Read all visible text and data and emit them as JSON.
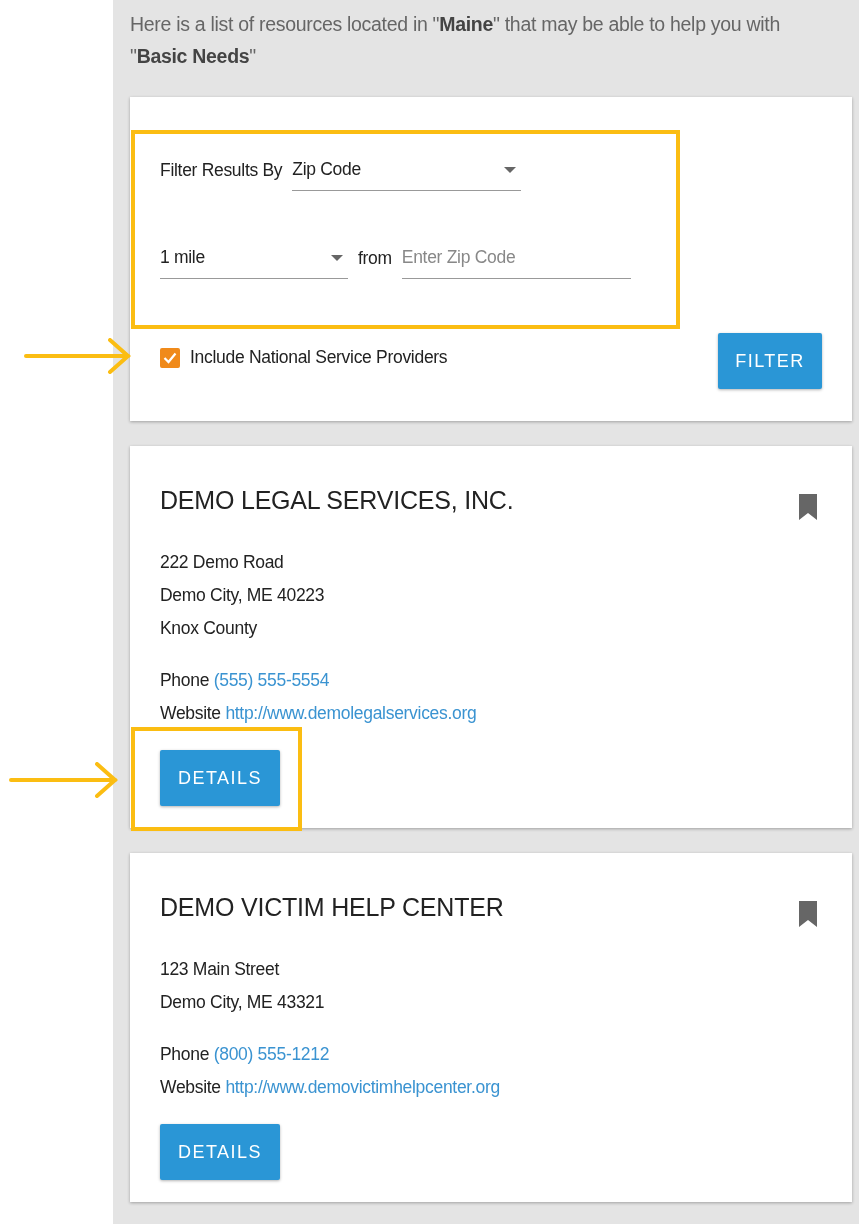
{
  "intro": "Here is a list of resources located in \"**Maine**\" that may be able to help you with \"**Basic Needs**\"",
  "filter": {
    "label": "Filter Results By",
    "filter_by": "Zip Code",
    "distance": "1 mile",
    "from_label": "from",
    "zip_placeholder": "Enter Zip Code",
    "include_national": {
      "label": "Include National Service Providers",
      "checked": true
    },
    "button": "FILTER"
  },
  "results": [
    {
      "name": "DEMO LEGAL SERVICES, INC.",
      "address_lines": [
        "222 Demo Road",
        "Demo City, ME 40223",
        "Knox County"
      ],
      "phone_label": "Phone",
      "phone": "(555) 555-5554",
      "website_label": "Website",
      "website": "http://www.demolegalservices.org",
      "button": "DETAILS"
    },
    {
      "name": "DEMO VICTIM HELP CENTER",
      "address_lines": [
        "123 Main Street",
        "Demo City, ME 43321"
      ],
      "phone_label": "Phone",
      "phone": "(800) 555-1212",
      "website_label": "Website",
      "website": "http://www.demovictimhelpcenter.org",
      "button": "DETAILS"
    }
  ]
}
